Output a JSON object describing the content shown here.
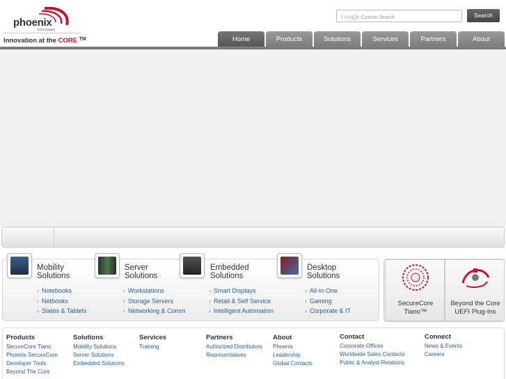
{
  "header": {
    "logo_text": "phoenix",
    "logo_sub": "technologies",
    "tagline_prefix": "Innovation at the",
    "tagline_core": "CORE",
    "tagline_tm": "TM",
    "search_brand": "Google",
    "search_placeholder": "Custom Search",
    "search_button": "Search"
  },
  "nav": {
    "tabs": [
      {
        "label": "Home"
      },
      {
        "label": "Products"
      },
      {
        "label": "Solutions"
      },
      {
        "label": "Services"
      },
      {
        "label": "Partners"
      },
      {
        "label": "About"
      }
    ],
    "active": "Home"
  },
  "solutions": [
    {
      "title1": "Mobility",
      "title2": "Solutions",
      "icon": "laptop-icon",
      "links": [
        "Notebooks",
        "Netbooks",
        "Slates & Tablets"
      ]
    },
    {
      "title1": "Server",
      "title2": "Solutions",
      "icon": "server-icon",
      "links": [
        "Workstations",
        "Storage Servers",
        "Networking & Comm"
      ]
    },
    {
      "title1": "Embedded",
      "title2": "Solutions",
      "icon": "chip-icon",
      "links": [
        "Smart Displays",
        "Retail & Self Service",
        "Intelligent Automation"
      ]
    },
    {
      "title1": "Desktop",
      "title2": "Solutions",
      "icon": "monitor-icon",
      "links": [
        "All-in-One",
        "Gaming",
        "Corporate & IT"
      ]
    }
  ],
  "promos": [
    {
      "line1": "SecureCore",
      "line2": "Tiano™",
      "icon": "securecore-logo-icon"
    },
    {
      "line1": "Beyond the Core",
      "line2": "UEFI Plug-Ins",
      "icon": "beyond-core-logo-icon"
    }
  ],
  "footer": [
    {
      "head": "Products",
      "links": [
        "SecureCore Tiano",
        "Phoenix SecureCore",
        "Developer Tools",
        "Beyond The Core"
      ]
    },
    {
      "head": "Solutions",
      "links": [
        "Mobility Solutions",
        "Server Solutions",
        "Embedded Solutions"
      ]
    },
    {
      "head": "Services",
      "links": [
        "Training"
      ]
    },
    {
      "head": "Partners",
      "links": [
        "Authorized Distributors",
        "Representatives"
      ]
    },
    {
      "head": "About",
      "links": [
        "Phoenix",
        "Leadership",
        "Global Contacts"
      ]
    },
    {
      "head": "Contact",
      "links": [
        "Corporate Offices",
        "Worldwide Sales Contacts",
        "Public & Analyst Relations"
      ]
    },
    {
      "head": "Connect",
      "links": [
        "News & Events",
        "Careers"
      ]
    }
  ],
  "colors": {
    "brand_red": "#c8102e",
    "link_blue": "#2a5a9c",
    "nav_gray": "#7a7a7a"
  }
}
